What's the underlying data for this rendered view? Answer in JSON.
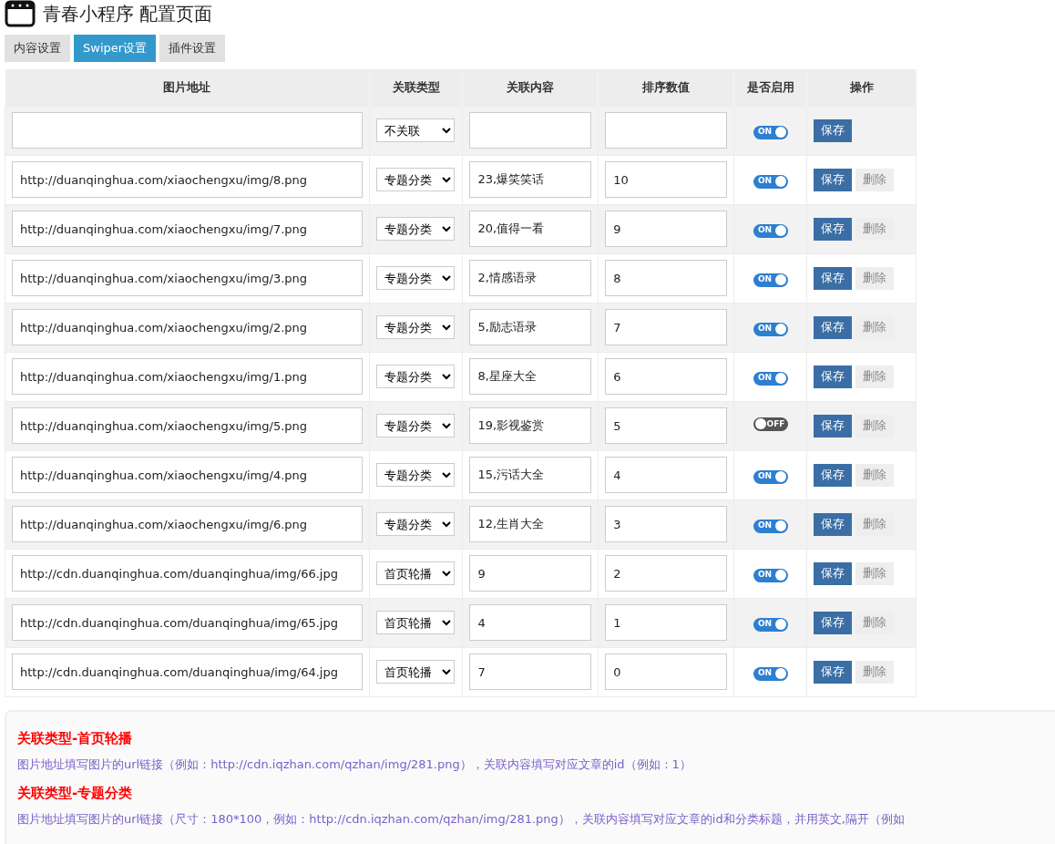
{
  "title": "青春小程序 配置页面",
  "tabs": [
    {
      "label": "内容设置",
      "selected": false
    },
    {
      "label": "Swiper设置",
      "selected": true
    },
    {
      "label": "插件设置",
      "selected": false
    }
  ],
  "table": {
    "columns": [
      "图片地址",
      "关联类型",
      "关联内容",
      "排序数值",
      "是否启用",
      "操作"
    ],
    "rows": [
      {
        "url": "",
        "type": "不关联",
        "content": "",
        "order": "",
        "on": true,
        "on_label": "ON",
        "save": "保存"
      },
      {
        "url": "http://duanqinghua.com/xiaochengxu/img/8.png",
        "type": "专题分类",
        "content": "23,爆笑笑话",
        "order": "10",
        "on": true,
        "on_label": "ON",
        "save": "保存",
        "delete": "删除"
      },
      {
        "url": "http://duanqinghua.com/xiaochengxu/img/7.png",
        "type": "专题分类",
        "content": "20,值得一看",
        "order": "9",
        "on": true,
        "on_label": "ON",
        "save": "保存",
        "delete": "删除"
      },
      {
        "url": "http://duanqinghua.com/xiaochengxu/img/3.png",
        "type": "专题分类",
        "content": "2,情感语录",
        "order": "8",
        "on": true,
        "on_label": "ON",
        "save": "保存",
        "delete": "删除"
      },
      {
        "url": "http://duanqinghua.com/xiaochengxu/img/2.png",
        "type": "专题分类",
        "content": "5,励志语录",
        "order": "7",
        "on": true,
        "on_label": "ON",
        "save": "保存",
        "delete": "删除"
      },
      {
        "url": "http://duanqinghua.com/xiaochengxu/img/1.png",
        "type": "专题分类",
        "content": "8,星座大全",
        "order": "6",
        "on": true,
        "on_label": "ON",
        "save": "保存",
        "delete": "删除"
      },
      {
        "url": "http://duanqinghua.com/xiaochengxu/img/5.png",
        "type": "专题分类",
        "content": "19,影视鉴赏",
        "order": "5",
        "on": false,
        "on_label": "OFF",
        "save": "保存",
        "delete": "删除"
      },
      {
        "url": "http://duanqinghua.com/xiaochengxu/img/4.png",
        "type": "专题分类",
        "content": "15,污话大全",
        "order": "4",
        "on": true,
        "on_label": "ON",
        "save": "保存",
        "delete": "删除"
      },
      {
        "url": "http://duanqinghua.com/xiaochengxu/img/6.png",
        "type": "专题分类",
        "content": "12,生肖大全",
        "order": "3",
        "on": true,
        "on_label": "ON",
        "save": "保存",
        "delete": "删除"
      },
      {
        "url": "http://cdn.duanqinghua.com/duanqinghua/img/66.jpg",
        "type": "首页轮播",
        "content": "9",
        "order": "2",
        "on": true,
        "on_label": "ON",
        "save": "保存",
        "delete": "删除"
      },
      {
        "url": "http://cdn.duanqinghua.com/duanqinghua/img/65.jpg",
        "type": "首页轮播",
        "content": "4",
        "order": "1",
        "on": true,
        "on_label": "ON",
        "save": "保存",
        "delete": "删除"
      },
      {
        "url": "http://cdn.duanqinghua.com/duanqinghua/img/64.jpg",
        "type": "首页轮播",
        "content": "7",
        "order": "0",
        "on": true,
        "on_label": "ON",
        "save": "保存",
        "delete": "删除"
      }
    ]
  },
  "notes": [
    {
      "kind": "heading",
      "text": "关联类型-首页轮播"
    },
    {
      "kind": "body",
      "text": "图片地址填写图片的url链接（例如：http://cdn.iqzhan.com/qzhan/img/281.png），关联内容填写对应文章的id（例如：1）"
    },
    {
      "kind": "heading",
      "text": "关联类型-专题分类"
    },
    {
      "kind": "body",
      "text": "图片地址填写图片的url链接（尺寸：180*100，例如：http://cdn.iqzhan.com/qzhan/img/281.png），关联内容填写对应文章的id和分类标题，并用英文,隔开（例如"
    }
  ]
}
